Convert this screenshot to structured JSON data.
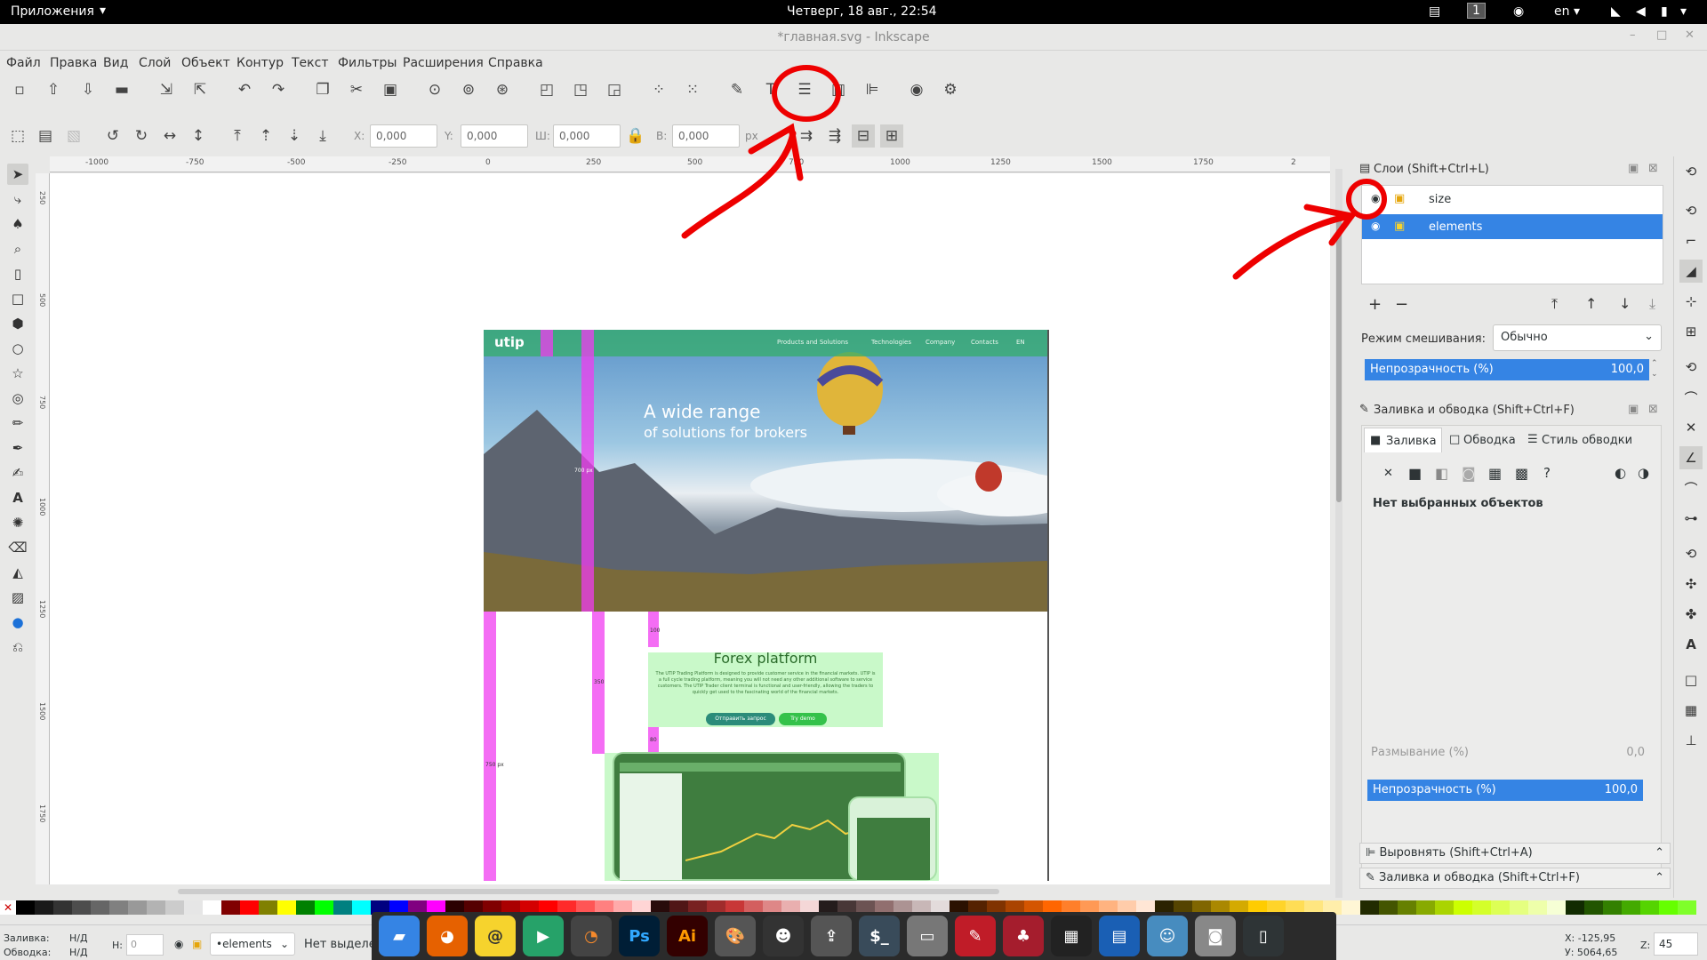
{
  "topbar": {
    "apps": "Приложения",
    "clock": "Четверг, 18 авг., 22:54",
    "workspace": "1",
    "lang": "en"
  },
  "window": {
    "title": "*главная.svg - Inkscape"
  },
  "menu": [
    "Файл",
    "Правка",
    "Вид",
    "Слой",
    "Объект",
    "Контур",
    "Текст",
    "Фильтры",
    "Расширения",
    "Справка"
  ],
  "toolbar2": {
    "x_label": "X:",
    "x_value": "0,000",
    "y_label": "Y:",
    "y_value": "0,000",
    "w_label": "Ш:",
    "w_value": "0,000",
    "h_label": "В:",
    "h_value": "0,000",
    "unit": "px"
  },
  "ruler": {
    "top": [
      "-1000",
      "-750",
      "-500",
      "-250",
      "0",
      "250",
      "500",
      "750",
      "1000",
      "1250",
      "1500",
      "1750",
      "2"
    ],
    "left": [
      "250",
      "500",
      "750",
      "1000",
      "1250",
      "1500",
      "1750"
    ]
  },
  "layers": {
    "title": "Слои (Shift+Ctrl+L)",
    "items": [
      "size",
      "elements"
    ],
    "blend_label": "Режим смешивания:",
    "blend_value": "Обычно",
    "opacity_label": "Непрозрачность (%)",
    "opacity_value": "100,0"
  },
  "fill": {
    "title": "Заливка и обводка (Shift+Ctrl+F)",
    "tab_fill": "Заливка",
    "tab_stroke": "Обводка",
    "tab_style": "Стиль обводки",
    "none_selected": "Нет выбранных объектов",
    "blur_label": "Размывание (%)",
    "blur_value": "0,0",
    "opacity_label": "Непрозрачность (%)",
    "opacity_value": "100,0"
  },
  "collapsed": {
    "align": "Выровнять (Shift+Ctrl+A)",
    "fill": "Заливка и обводка (Shift+Ctrl+F)"
  },
  "status": {
    "fill_label": "Заливка:",
    "fill_value": "Н/Д",
    "stroke_label": "Обводка:",
    "stroke_value": "Н/Д",
    "h_label": "Н:",
    "h_value": "0",
    "layer": "•elements",
    "message": "Нет выделе",
    "coords_x": "X: -125,95",
    "coords_y": "У: 5064,65",
    "zoom_label": "Z:",
    "zoom_value": "45"
  },
  "artboard": {
    "logo": "utip",
    "nav": [
      "Products and Solutions",
      "Technologies",
      "Company",
      "Contacts",
      "EN"
    ],
    "hero_title": "A wide range",
    "hero_sub": "of solutions for brokers",
    "section_title": "Forex platform",
    "section_body": "The UTIP Trading Platform is designed to provide customer service in the financial markets. UTIP is a full cycle trading platform, meaning you will not need any other additional software to service customers. The UTIP Trader client terminal is functional and user-friendly, allowing the traders to quickly get used to the fascinating world of the financial markets.",
    "btn_request": "Отправить запрос",
    "btn_demo": "Try demo",
    "dim_700": "700 px",
    "dim_750": "750 px",
    "dim_100": "100",
    "dim_350": "350",
    "dim_80": "80"
  },
  "palette": [
    "#000000",
    "#1a1a1a",
    "#333333",
    "#4d4d4d",
    "#666666",
    "#808080",
    "#999999",
    "#b3b3b3",
    "#cccccc",
    "#e6e6e6",
    "#ffffff",
    "#800000",
    "#ff0000",
    "#808000",
    "#ffff00",
    "#008000",
    "#00ff00",
    "#008080",
    "#00ffff",
    "#000080",
    "#0000ff",
    "#800080",
    "#ff00ff",
    "#2b0000",
    "#550000",
    "#800000",
    "#aa0000",
    "#d40000",
    "#ff0000",
    "#ff2a2a",
    "#ff5555",
    "#ff8080",
    "#ffaaaa",
    "#ffd5d5",
    "#280b0b",
    "#501616",
    "#782121",
    "#a02c2c",
    "#c83737",
    "#d35f5f",
    "#de8787",
    "#e9afaf",
    "#f4d7d7",
    "#241c1c",
    "#483737",
    "#6c5353",
    "#916f6f",
    "#ac9393",
    "#c8b7b7",
    "#e3dbdb",
    "#2b1100",
    "#552200",
    "#803300",
    "#aa4400",
    "#d45500",
    "#ff6600",
    "#ff7f2a",
    "#ff9955",
    "#ffb380",
    "#ffccaa",
    "#ffe6d5",
    "#2b2200",
    "#554400",
    "#806600",
    "#aa8800",
    "#d4aa00",
    "#ffcc00",
    "#ffd42a",
    "#ffdd55",
    "#ffe680",
    "#ffeeaa",
    "#fff6d5",
    "#222b00",
    "#445500",
    "#668000",
    "#88aa00",
    "#aad400",
    "#ccff00",
    "#d4ff2a",
    "#ddff55",
    "#e5ff80",
    "#eeffaa",
    "#f6ffd5",
    "#112b00",
    "#225500",
    "#338000",
    "#44aa00",
    "#55d400",
    "#66ff00",
    "#7fff2a"
  ]
}
